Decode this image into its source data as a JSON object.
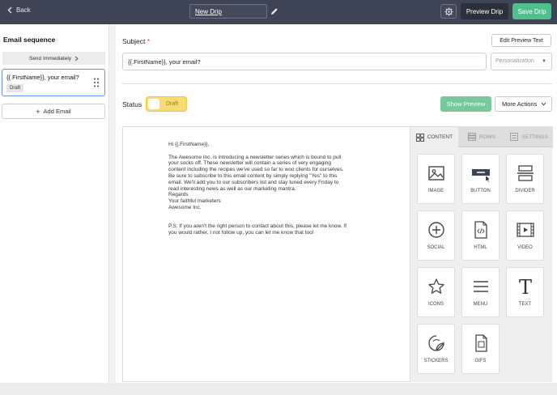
{
  "topbar": {
    "back_label": "Back",
    "drip_name": "New Drip",
    "preview_drip_label": "Preview Drip",
    "save_drip_label": "Save Drip"
  },
  "sidebar": {
    "title": "Email sequence",
    "send_immediately": "Send Immediately",
    "email_card": {
      "subject": "{{.FirstName}}, your email?",
      "badge": "Draft"
    },
    "add_email": "Add Email"
  },
  "main": {
    "subject_label": "Subject",
    "required_mark": "*",
    "edit_preview_text": "Edit Preview Text",
    "subject_value": "{{.FirstName}}, your email?",
    "personalization_placeholder": "Personalization",
    "status_label": "Status",
    "status_value": "Draft",
    "show_preview": "Show Preview",
    "more_actions": "More Actions"
  },
  "email_body": {
    "greeting": "Hi {{.FirstName}},",
    "lines": [
      "The Awesome Inc. is introducing a newsletter series which is bound to pull",
      "your socks off. These newsletter will contain a series of very engaging",
      "content including the recipes we've used so far to woo clients for ourselves.",
      "Be sure to subscribe to this email content by simply replying \"Yes\" to this",
      "email. We'll add you to our subscribers list and stay tuned every Friday to",
      "read interesting news as well as our marketing mantra.",
      "Regards",
      "Your faithful marketers",
      "Awesome Inc."
    ],
    "ps_lines": [
      "P.S: If you aren't the right person to contact about this, please let me know. If",
      "you would rather, I not follow up, you can let me know that too!"
    ]
  },
  "tools": {
    "tabs": [
      "CONTENT",
      "ROWS",
      "SETTINGS"
    ],
    "tiles": [
      "IMAGE",
      "BUTTON",
      "DIVIDER",
      "SOCIAL",
      "HTML",
      "VIDEO",
      "ICONS",
      "MENU",
      "TEXT",
      "STICKERS",
      "GIFS"
    ]
  },
  "colors": {
    "topbar": "#3d4453",
    "save": "#4fc08d",
    "show_preview": "#76c99b",
    "draft_toggle": "#f7dc73",
    "selected_card_border": "#6b8fd6"
  }
}
